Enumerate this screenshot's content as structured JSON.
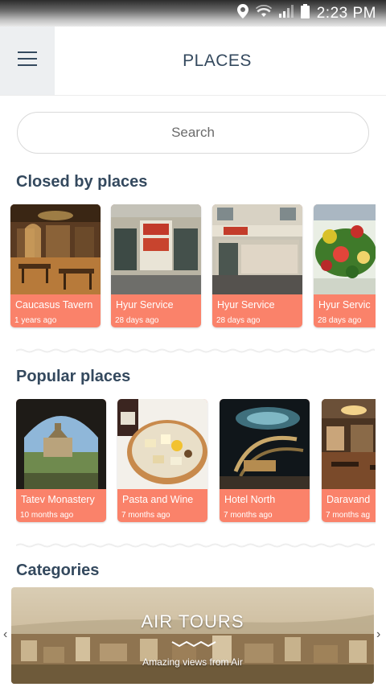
{
  "status_bar": {
    "time": "2:23 PM",
    "icons": [
      "location-icon",
      "wifi-icon",
      "signal-icon",
      "battery-icon"
    ]
  },
  "header": {
    "title": "PLACES",
    "menu_icon": "hamburger-menu-icon"
  },
  "search": {
    "placeholder": "Search"
  },
  "closed_places": {
    "title": "Closed by places",
    "items": [
      {
        "name": "Caucasus Tavern",
        "time": "1 years ago",
        "image": "tavern-interior"
      },
      {
        "name": "Hyur Service",
        "time": "28 days ago",
        "image": "hyur-storefront"
      },
      {
        "name": "Hyur Service",
        "time": "28 days ago",
        "image": "hyur-street-front"
      },
      {
        "name": "Hyur Servic",
        "time": "28 days ago",
        "image": "food-platter"
      }
    ]
  },
  "popular_places": {
    "title": "Popular places",
    "items": [
      {
        "name": "Tatev Monastery",
        "time": "10 months ago",
        "image": "monastery-arch"
      },
      {
        "name": "Pasta and Wine",
        "time": "7 months ago",
        "image": "cheese-plate"
      },
      {
        "name": "Hotel North",
        "time": "7 months ago",
        "image": "hotel-staircase"
      },
      {
        "name": "Daravand",
        "time": "7 months ag",
        "image": "restaurant-hall"
      }
    ]
  },
  "categories": {
    "title": "Categories",
    "banner": {
      "title": "AIR TOURS",
      "subtitle": "Amazing views from Air"
    },
    "prev_icon": "chevron-left-icon",
    "next_icon": "chevron-right-icon"
  },
  "colors": {
    "accent": "#fa826a",
    "heading": "#34495e",
    "menu_bg": "#edeff1"
  }
}
